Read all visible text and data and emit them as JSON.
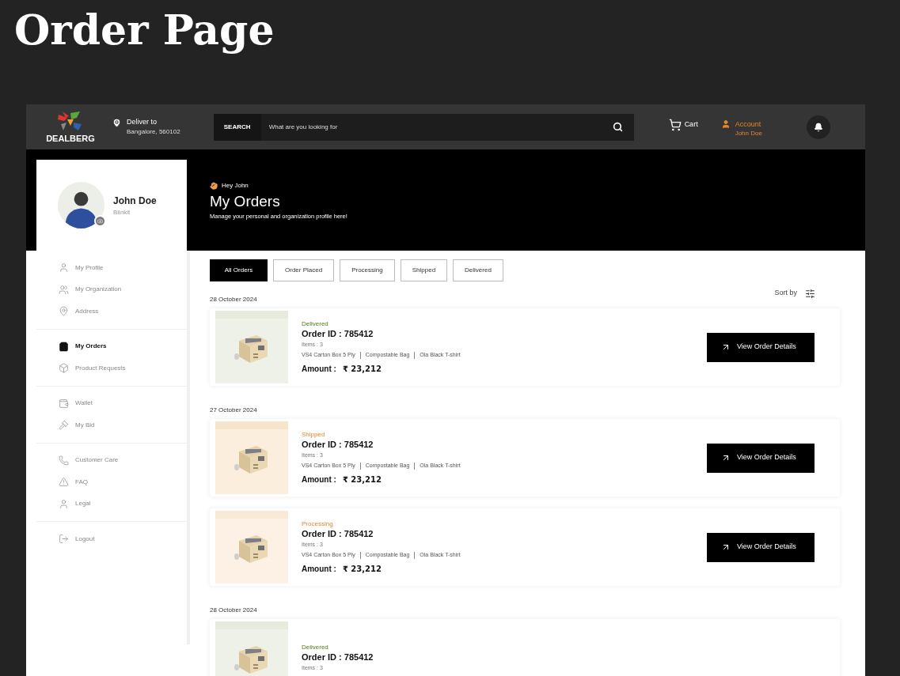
{
  "title": "Order Page",
  "header": {
    "logo": "DEALBERG",
    "deliver_label": "Deliver to",
    "deliver_location": "Bangalore, 560102",
    "search_label": "SEARCH",
    "search_placeholder": "What are you looking for",
    "cart": "Cart",
    "account_label": "Account",
    "account_name": "John Doe"
  },
  "profile": {
    "name": "John Doe",
    "organization": "Blinkit"
  },
  "sidebar": {
    "groups": [
      {
        "items": [
          {
            "label": "My Profile",
            "selected": false
          },
          {
            "label": "My Organization",
            "selected": false
          },
          {
            "label": "Address",
            "selected": false
          }
        ]
      },
      {
        "items": [
          {
            "label": "My Orders",
            "selected": true
          },
          {
            "label": "Product Requests",
            "selected": false
          }
        ]
      },
      {
        "items": [
          {
            "label": "Wallet",
            "selected": false
          },
          {
            "label": "My Bid",
            "selected": false
          }
        ]
      },
      {
        "items": [
          {
            "label": "Customer Care",
            "selected": false
          },
          {
            "label": "FAQ",
            "selected": false
          },
          {
            "label": "Legal",
            "selected": false
          }
        ]
      },
      {
        "items": [
          {
            "label": "Logout",
            "selected": false
          }
        ]
      }
    ]
  },
  "hero": {
    "greeting": "Hey John",
    "heading": "My Orders",
    "subtitle": "Manage your personal and organization profile here!"
  },
  "tabs": [
    {
      "label": "All Orders",
      "selected": true
    },
    {
      "label": "Order Placed",
      "selected": false
    },
    {
      "label": "Processing",
      "selected": false
    },
    {
      "label": "Shipped",
      "selected": false
    },
    {
      "label": "Delivered",
      "selected": false
    }
  ],
  "sort_label": "Sort by",
  "order_groups": [
    {
      "date": "28 October 2024",
      "orders": [
        {
          "status": "Delivered",
          "kind": "delivered",
          "order_id": "Order ID : 785412",
          "items": "Items : 3",
          "products": [
            "VS4 Carton Box 5 Ply",
            "Compostable Bag",
            "Ola Black T-shirt"
          ],
          "amount_label": "Amount :",
          "amount": "₹ 23,212",
          "button": "View Order Details"
        }
      ]
    },
    {
      "date": "27 October 2024",
      "orders": [
        {
          "status": "Shipped",
          "kind": "shipped",
          "order_id": "Order ID : 785412",
          "items": "Items : 3",
          "products": [
            "VS4 Carton Box 5 Ply",
            "Compostable Bag",
            "Ola Black T-shirt"
          ],
          "amount_label": "Amount :",
          "amount": "₹ 23,212",
          "button": "View Order Details"
        },
        {
          "status": "Processing",
          "kind": "processing",
          "order_id": "Order ID : 785412",
          "items": "Items : 3",
          "products": [
            "VS4 Carton Box 5 Ply",
            "Compostable Bag",
            "Ola Black T-shirt"
          ],
          "amount_label": "Amount :",
          "amount": "₹ 23,212",
          "button": "View Order Details"
        }
      ]
    },
    {
      "date": "28 October 2024",
      "orders": [
        {
          "status": "Delivered",
          "kind": "delivered",
          "order_id": "Order ID : 785412",
          "items": "Items : 3"
        }
      ]
    }
  ]
}
